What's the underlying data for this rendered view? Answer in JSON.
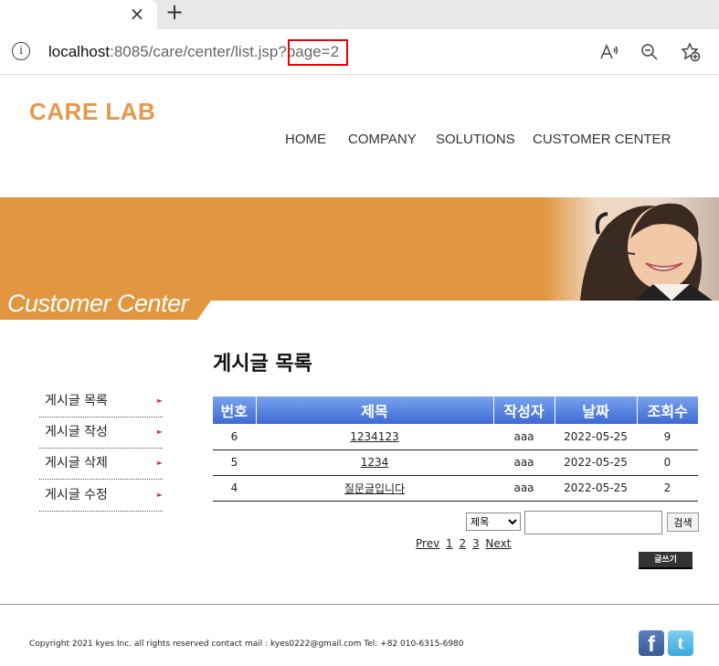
{
  "browser": {
    "url_host": "localhost",
    "url_rest": ":8085/care/center/list.jsp",
    "url_query": "?page=2"
  },
  "site": {
    "logo": "CARE LAB",
    "nav": [
      "HOME",
      "COMPANY",
      "SOLUTIONS",
      "CUSTOMER CENTER"
    ],
    "banner_title": "Customer Center"
  },
  "sidebar": {
    "items": [
      {
        "label": "게시글 목록"
      },
      {
        "label": "게시글 작성"
      },
      {
        "label": "게시글 삭제"
      },
      {
        "label": "게시글 수정"
      }
    ]
  },
  "board": {
    "title": "게시글 목록",
    "columns": [
      "번호",
      "제목",
      "작성자",
      "날짜",
      "조회수"
    ],
    "rows": [
      {
        "no": "6",
        "subject": "1234123",
        "writer": "aaa",
        "date": "2022-05-25",
        "views": "9"
      },
      {
        "no": "5",
        "subject": "1234",
        "writer": "aaa",
        "date": "2022-05-25",
        "views": "0"
      },
      {
        "no": "4",
        "subject": "질문글입니다",
        "writer": "aaa",
        "date": "2022-05-25",
        "views": "2"
      }
    ],
    "search": {
      "field_selected": "제목",
      "query": "",
      "button": "검색"
    },
    "paging": {
      "prev": "Prev",
      "pages": [
        "1",
        "2",
        "3"
      ],
      "next": "Next"
    },
    "write_button": "글쓰기"
  },
  "footer": {
    "copyright": "Copyright 2021 kyes Inc. all rights reserved contact mail : kyes0222@gmail.com Tel: +82 010-6315-6980"
  },
  "colors": {
    "brand_orange": "#e1963f",
    "table_header_blue": "#4a78dc",
    "url_highlight": "#e00000"
  },
  "icons": [
    "close-icon",
    "plus-icon",
    "info-icon",
    "read-aloud-icon",
    "zoom-out-icon",
    "favorite-add-icon",
    "facebook-icon",
    "twitter-icon"
  ]
}
